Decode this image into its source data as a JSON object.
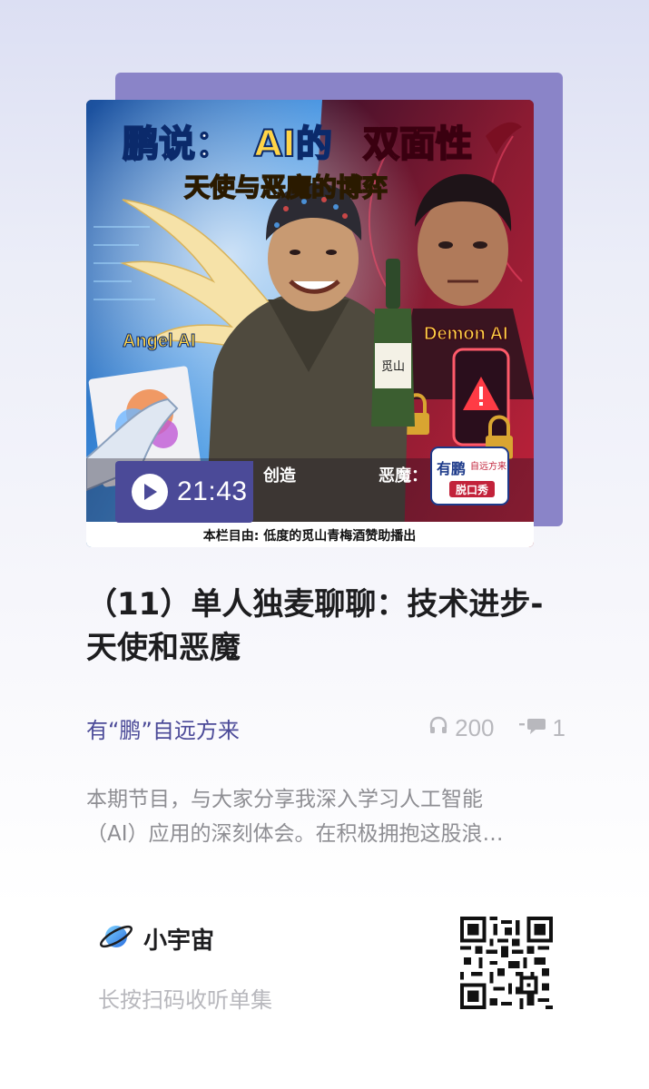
{
  "cover": {
    "headline_left": "鹏说：",
    "headline_ai": "AI的",
    "headline_right": "双面性",
    "subheadline": "天使与恶魔的博弈",
    "angel_label": "Angel AI",
    "demon_label": "Demon AI",
    "bottom_left_caption": "创造",
    "bottom_right_caption": "恶魔：",
    "sponsor_strip": "本栏目由: 低度的觅山青梅酒赞助播出",
    "bottle_label": "觅山",
    "badge_line1": "有鹏",
    "badge_line2": "自远方来",
    "badge_line3": "脱口秀"
  },
  "player": {
    "duration": "21:43"
  },
  "episode": {
    "title": "（11）单人独麦聊聊：技术进步-天使和恶魔",
    "podcast_name": "有“鹏”自远方来",
    "plays": "200",
    "comments": "1",
    "description_line1": "本期节目，与大家分享我深入学习人工智能",
    "description_line2": "（AI）应用的深刻体会。在积极拥抱这股浪…"
  },
  "footer": {
    "brand": "小宇宙",
    "hint": "长按扫码收听单集"
  },
  "colors": {
    "accent": "#4b4a98",
    "muted": "#b8b8bd",
    "cover_back": "#8a84c8",
    "angel_blue": "#2b7bd6",
    "demon_red": "#c2223a"
  },
  "icons": {
    "play": "play-icon",
    "headphones": "headphones-icon",
    "comment": "comment-icon",
    "brand": "planet-logo-icon",
    "qr": "qr-code"
  }
}
